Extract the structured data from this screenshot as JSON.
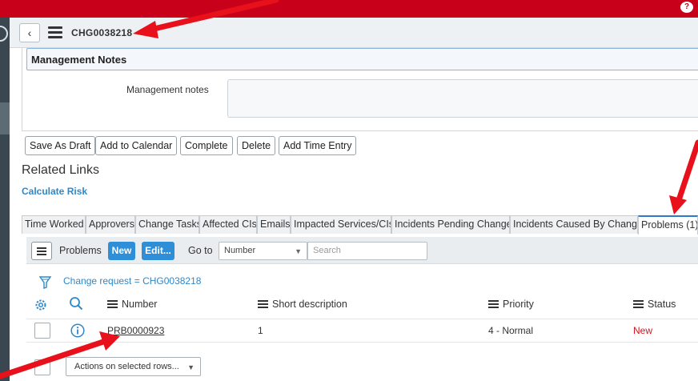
{
  "topbar": {
    "help_glyph": "?"
  },
  "header": {
    "back_glyph": "‹",
    "record_number": "CHG0038218"
  },
  "form": {
    "section_title": "Management Notes",
    "management_notes_label": "Management notes",
    "management_notes_value": ""
  },
  "actions": {
    "buttons": [
      "Save As Draft",
      "Add to Calendar",
      "Complete",
      "Delete",
      "Add Time Entry"
    ]
  },
  "related_links": {
    "title": "Related Links",
    "calculate_risk": "Calculate Risk"
  },
  "tabs": [
    {
      "label": "Time Worked",
      "active": false
    },
    {
      "label": "Approvers",
      "active": false
    },
    {
      "label": "Change Tasks",
      "active": false
    },
    {
      "label": "Affected CIs",
      "active": false
    },
    {
      "label": "Emails",
      "active": false
    },
    {
      "label": "Impacted Services/CIs",
      "active": false
    },
    {
      "label": "Incidents Pending Change",
      "active": false
    },
    {
      "label": "Incidents Caused By Change",
      "active": false
    },
    {
      "label": "Problems (1)",
      "active": true
    }
  ],
  "list": {
    "title": "Problems",
    "new_label": "New",
    "edit_label": "Edit...",
    "goto_label": "Go to",
    "goto_value": "Number",
    "search_placeholder": "Search",
    "filter_text": "Change request = CHG0038218",
    "columns": [
      "Number",
      "Short description",
      "Priority",
      "Status"
    ],
    "rows": [
      {
        "number": "PRB0000923",
        "short_description": "1",
        "priority": "4 - Normal",
        "status": "New"
      }
    ],
    "actions_select": "Actions on selected rows..."
  },
  "colors": {
    "topbar": "#c8001a",
    "accent_blue": "#2f8ed8",
    "link_blue": "#2e88c9",
    "status_red": "#d8121b",
    "annotation_arrow": "#e8101a"
  }
}
